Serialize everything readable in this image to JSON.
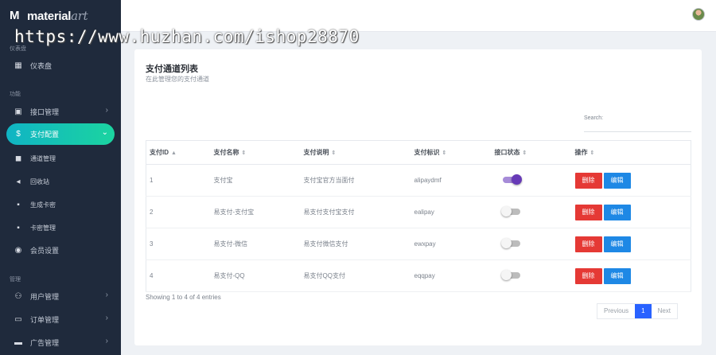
{
  "app": {
    "logo_mark": "M",
    "logo_text": "material",
    "logo_text_italic": "art"
  },
  "watermark": "https://www.huzhan.com/ishop28870",
  "sidebar": {
    "section1": "仪表盘",
    "dashboard": "仪表盘",
    "section2": "功能",
    "items": [
      {
        "label": "接口管理",
        "icon": "key-icon"
      },
      {
        "label": "支付配置",
        "icon": "dollar-icon"
      },
      {
        "label": "通道管理",
        "icon": "layers-icon"
      },
      {
        "label": "回收站",
        "icon": "trash-icon"
      },
      {
        "label": "生成卡密",
        "icon": "card-icon"
      },
      {
        "label": "卡密管理",
        "icon": "card-manage-icon"
      },
      {
        "label": "会员设置",
        "icon": "member-icon"
      }
    ],
    "section3": "管理",
    "admin_items": [
      {
        "label": "用户管理",
        "icon": "users-icon"
      },
      {
        "label": "订单管理",
        "icon": "order-icon"
      },
      {
        "label": "广告管理",
        "icon": "ad-icon"
      }
    ]
  },
  "card": {
    "title": "支付通道列表",
    "subtitle": "在此管理您的支付通道",
    "search_label": "Search:"
  },
  "table": {
    "headers": [
      "支付ID",
      "支付名称",
      "支付说明",
      "支付标识",
      "接口状态",
      "操作"
    ],
    "rows": [
      {
        "id": "1",
        "name": "支付宝",
        "desc": "支付宝官方当面付",
        "key": "alipaydmf",
        "status": true
      },
      {
        "id": "2",
        "name": "易支付-支付宝",
        "desc": "易支付支付宝支付",
        "key": "ealipay",
        "status": false
      },
      {
        "id": "3",
        "name": "易支付-微信",
        "desc": "易支付微信支付",
        "key": "ewxpay",
        "status": false
      },
      {
        "id": "4",
        "name": "易支付-QQ",
        "desc": "易支付QQ支付",
        "key": "eqqpay",
        "status": false
      }
    ],
    "delete_label": "删除",
    "edit_label": "编辑"
  },
  "footer": {
    "entries": "Showing 1 to 4 of 4 entries",
    "prev": "Previous",
    "page": "1",
    "next": "Next"
  },
  "colors": {
    "sidebar_bg": "#1f2a3c",
    "active_gradient_start": "#10b4c4",
    "active_gradient_end": "#1bd4a0",
    "delete": "#e53935",
    "edit": "#1e88e5",
    "page_active": "#2962ff",
    "toggle_on": "#673ab7"
  }
}
